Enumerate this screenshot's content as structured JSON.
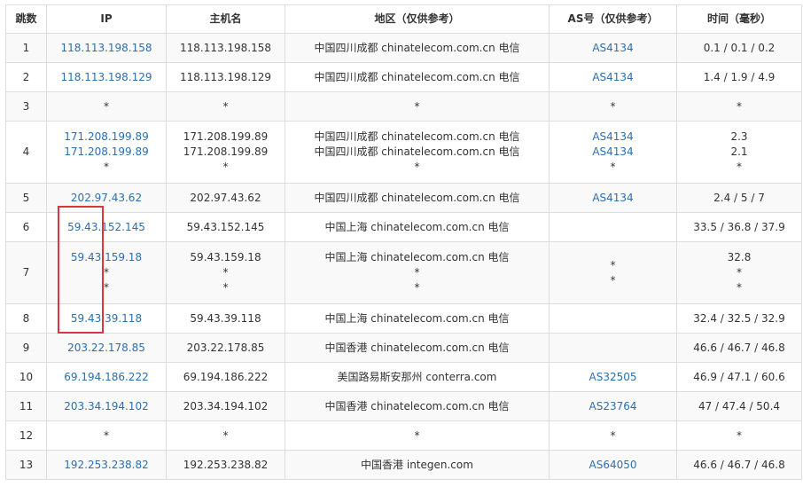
{
  "headers": {
    "hop": "跳数",
    "ip": "IP",
    "host": "主机名",
    "region": "地区（仅供参考）",
    "asn": "AS号（仅供参考）",
    "time": "时间（毫秒）"
  },
  "rows": [
    {
      "hop": "1",
      "ip": [
        "118.113.198.158"
      ],
      "host": [
        "118.113.198.158"
      ],
      "region": [
        "中国四川成都 chinatelecom.com.cn 电信"
      ],
      "asn": [
        "AS4134"
      ],
      "time": [
        "0.1 / 0.1 / 0.2"
      ]
    },
    {
      "hop": "2",
      "ip": [
        "118.113.198.129"
      ],
      "host": [
        "118.113.198.129"
      ],
      "region": [
        "中国四川成都 chinatelecom.com.cn 电信"
      ],
      "asn": [
        "AS4134"
      ],
      "time": [
        "1.4 / 1.9 / 4.9"
      ]
    },
    {
      "hop": "3",
      "ip": [
        "*"
      ],
      "host": [
        "*"
      ],
      "region": [
        "*"
      ],
      "asn": [
        "*"
      ],
      "time": [
        "*"
      ]
    },
    {
      "hop": "4",
      "ip": [
        "171.208.199.89",
        "171.208.199.89",
        "*"
      ],
      "host": [
        "171.208.199.89",
        "171.208.199.89",
        "*"
      ],
      "region": [
        "中国四川成都 chinatelecom.com.cn 电信",
        "中国四川成都 chinatelecom.com.cn 电信",
        "*"
      ],
      "asn": [
        "AS4134",
        "AS4134",
        "*"
      ],
      "time": [
        "2.3",
        "2.1",
        "*"
      ]
    },
    {
      "hop": "5",
      "ip": [
        "202.97.43.62"
      ],
      "host": [
        "202.97.43.62"
      ],
      "region": [
        "中国四川成都 chinatelecom.com.cn 电信"
      ],
      "asn": [
        "AS4134"
      ],
      "time": [
        "2.4 / 5 / 7"
      ]
    },
    {
      "hop": "6",
      "ip": [
        "59.43.152.145"
      ],
      "host": [
        "59.43.152.145"
      ],
      "region": [
        "中国上海 chinatelecom.com.cn 电信"
      ],
      "asn": [
        ""
      ],
      "time": [
        "33.5 / 36.8 / 37.9"
      ]
    },
    {
      "hop": "7",
      "ip": [
        "59.43.159.18",
        "*",
        "*"
      ],
      "host": [
        "59.43.159.18",
        "*",
        "*"
      ],
      "region": [
        "中国上海 chinatelecom.com.cn 电信",
        "*",
        "*"
      ],
      "asn": [
        "",
        "*",
        "*"
      ],
      "time": [
        "32.8",
        "*",
        "*"
      ]
    },
    {
      "hop": "8",
      "ip": [
        "59.43.39.118"
      ],
      "host": [
        "59.43.39.118"
      ],
      "region": [
        "中国上海 chinatelecom.com.cn 电信"
      ],
      "asn": [
        ""
      ],
      "time": [
        "32.4 / 32.5 / 32.9"
      ]
    },
    {
      "hop": "9",
      "ip": [
        "203.22.178.85"
      ],
      "host": [
        "203.22.178.85"
      ],
      "region": [
        "中国香港 chinatelecom.com.cn 电信"
      ],
      "asn": [
        ""
      ],
      "time": [
        "46.6 / 46.7 / 46.8"
      ]
    },
    {
      "hop": "10",
      "ip": [
        "69.194.186.222"
      ],
      "host": [
        "69.194.186.222"
      ],
      "region": [
        "美国路易斯安那州 conterra.com"
      ],
      "asn": [
        "AS32505"
      ],
      "time": [
        "46.9 / 47.1 / 60.6"
      ]
    },
    {
      "hop": "11",
      "ip": [
        "203.34.194.102"
      ],
      "host": [
        "203.34.194.102"
      ],
      "region": [
        "中国香港 chinatelecom.com.cn 电信"
      ],
      "asn": [
        "AS23764"
      ],
      "time": [
        "47 / 47.4 / 50.4"
      ]
    },
    {
      "hop": "12",
      "ip": [
        "*"
      ],
      "host": [
        "*"
      ],
      "region": [
        "*"
      ],
      "asn": [
        "*"
      ],
      "time": [
        "*"
      ]
    },
    {
      "hop": "13",
      "ip": [
        "192.253.238.82"
      ],
      "host": [
        "192.253.238.82"
      ],
      "region": [
        "中国香港 integen.com"
      ],
      "asn": [
        "AS64050"
      ],
      "time": [
        "46.6 / 46.7 / 46.8"
      ]
    }
  ],
  "colors": {
    "link": "#2a6fb0",
    "text": "#333333",
    "border": "#dddddd",
    "row_alt": "#f9f9f9",
    "highlight": "#d9363e"
  }
}
